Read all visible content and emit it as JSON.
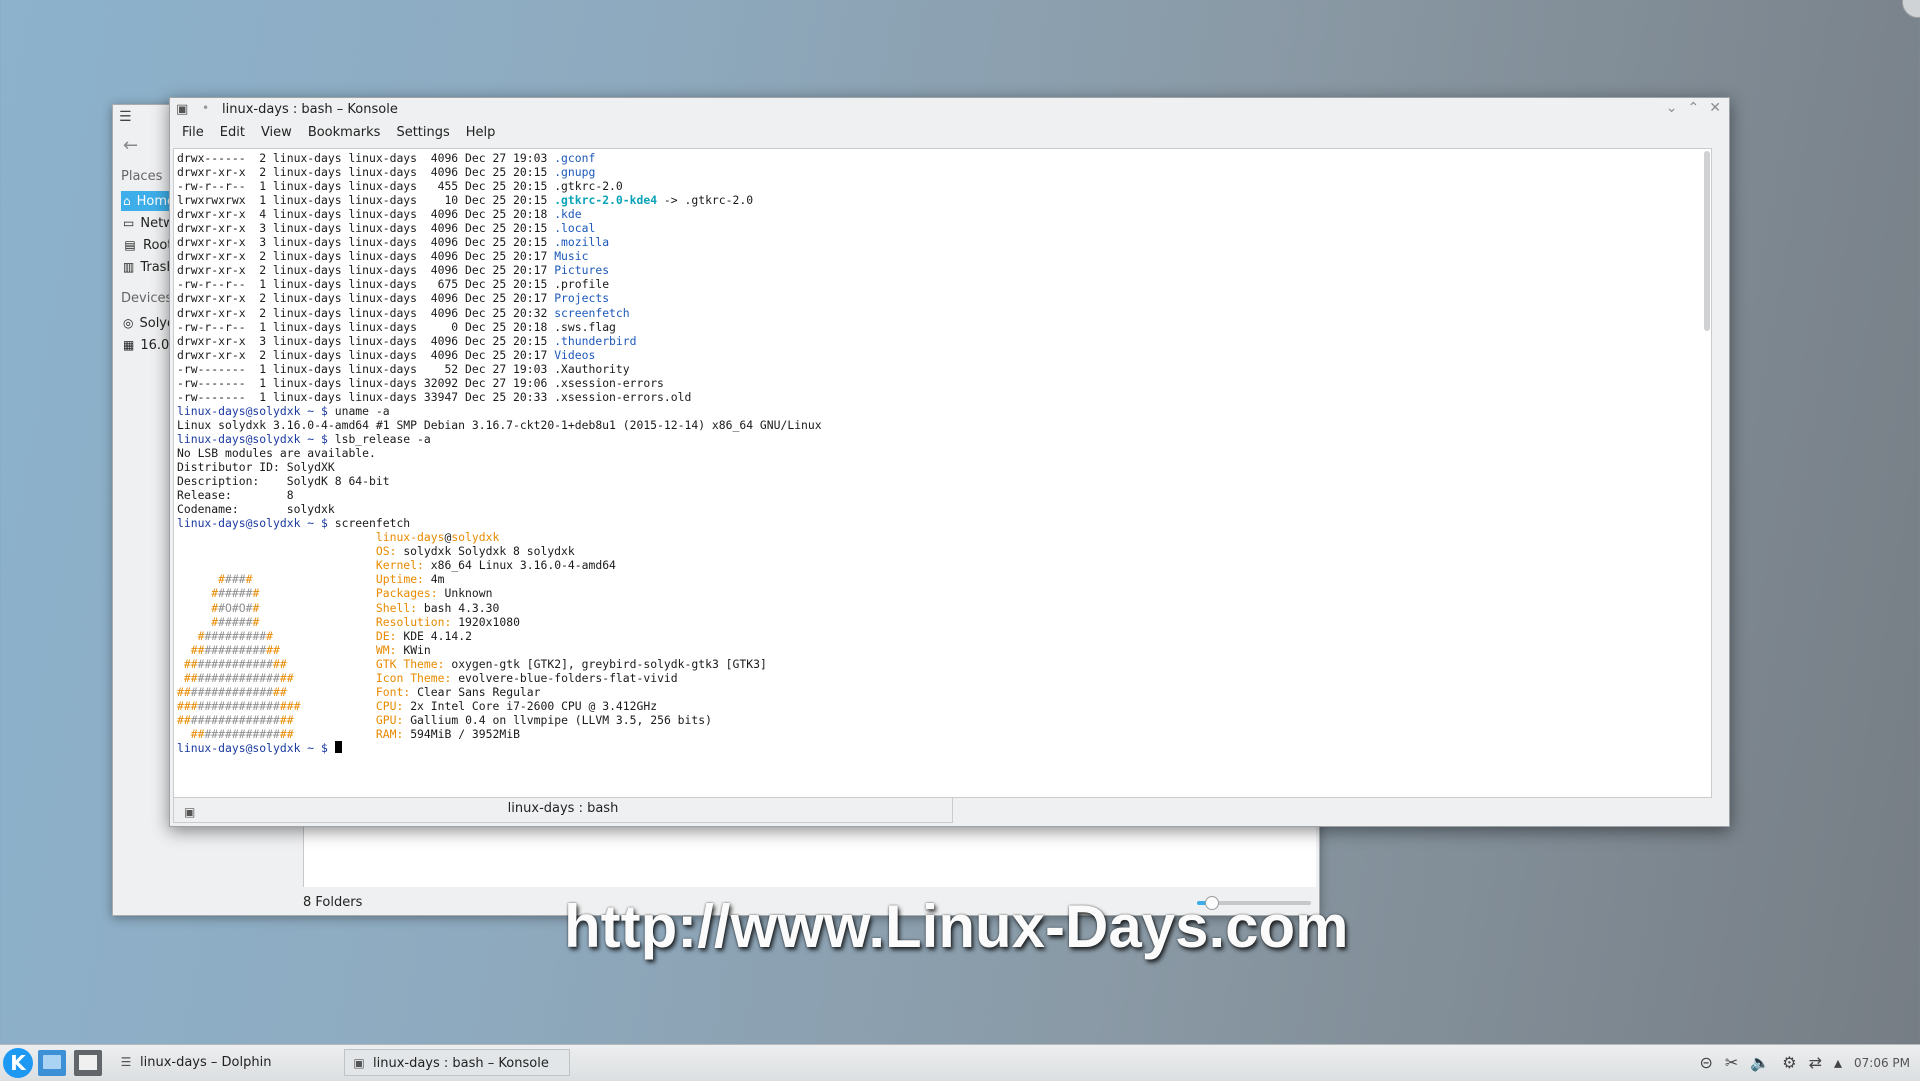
{
  "dolphin": {
    "places_label": "Places",
    "devices_label": "Devices",
    "places": [
      {
        "label": "Home",
        "icon": "home-icon"
      },
      {
        "label": "Network",
        "icon": "network-icon"
      },
      {
        "label": "Root",
        "icon": "root-folder-icon"
      },
      {
        "label": "Trash",
        "icon": "trash-icon"
      }
    ],
    "devices": [
      {
        "label": "SolydXK",
        "icon": "drive-icon"
      },
      {
        "label": "16.0 GiB",
        "icon": "harddisk-icon"
      }
    ],
    "status": "8 Folders",
    "zoom_level": 0.12
  },
  "konsole": {
    "title": "linux-days : bash – Konsole",
    "menu": [
      "File",
      "Edit",
      "View",
      "Bookmarks",
      "Settings",
      "Help"
    ],
    "tab_label": "linux-days : bash",
    "ls_lines": [
      {
        "meta": "drwx------  2 linux-days linux-days  4096 Dec 27 19:03 ",
        "name": ".gconf",
        "cls": "c-blue"
      },
      {
        "meta": "drwxr-xr-x  2 linux-days linux-days  4096 Dec 25 20:15 ",
        "name": ".gnupg",
        "cls": "c-blue"
      },
      {
        "meta": "-rw-r--r--  1 linux-days linux-days   455 Dec 25 20:15 ",
        "name": ".gtkrc-2.0",
        "cls": ""
      },
      {
        "meta": "lrwxrwxrwx  1 linux-days linux-days    10 Dec 25 20:15 ",
        "name": ".gtkrc-2.0-kde4",
        "cls": "c-cyan",
        "suffix": " -> .gtkrc-2.0"
      },
      {
        "meta": "drwxr-xr-x  4 linux-days linux-days  4096 Dec 25 20:18 ",
        "name": ".kde",
        "cls": "c-blue"
      },
      {
        "meta": "drwxr-xr-x  3 linux-days linux-days  4096 Dec 25 20:15 ",
        "name": ".local",
        "cls": "c-blue"
      },
      {
        "meta": "drwxr-xr-x  3 linux-days linux-days  4096 Dec 25 20:15 ",
        "name": ".mozilla",
        "cls": "c-blue"
      },
      {
        "meta": "drwxr-xr-x  2 linux-days linux-days  4096 Dec 25 20:17 ",
        "name": "Music",
        "cls": "c-blue"
      },
      {
        "meta": "drwxr-xr-x  2 linux-days linux-days  4096 Dec 25 20:17 ",
        "name": "Pictures",
        "cls": "c-blue"
      },
      {
        "meta": "-rw-r--r--  1 linux-days linux-days   675 Dec 25 20:15 ",
        "name": ".profile",
        "cls": ""
      },
      {
        "meta": "drwxr-xr-x  2 linux-days linux-days  4096 Dec 25 20:17 ",
        "name": "Projects",
        "cls": "c-blue"
      },
      {
        "meta": "drwxr-xr-x  2 linux-days linux-days  4096 Dec 25 20:32 ",
        "name": "screenfetch",
        "cls": "c-blue"
      },
      {
        "meta": "-rw-r--r--  1 linux-days linux-days     0 Dec 25 20:18 ",
        "name": ".sws.flag",
        "cls": ""
      },
      {
        "meta": "drwxr-xr-x  3 linux-days linux-days  4096 Dec 25 20:15 ",
        "name": ".thunderbird",
        "cls": "c-blue"
      },
      {
        "meta": "drwxr-xr-x  2 linux-days linux-days  4096 Dec 25 20:17 ",
        "name": "Videos",
        "cls": "c-blue"
      },
      {
        "meta": "-rw-------  1 linux-days linux-days    52 Dec 27 19:03 ",
        "name": ".Xauthority",
        "cls": ""
      },
      {
        "meta": "-rw-------  1 linux-days linux-days 32092 Dec 27 19:06 ",
        "name": ".xsession-errors",
        "cls": ""
      },
      {
        "meta": "-rw-------  1 linux-days linux-days 33947 Dec 25 20:33 ",
        "name": ".xsession-errors.old",
        "cls": ""
      }
    ],
    "prompt": "linux-days@solydxk ~ $ ",
    "cmd_uname": "uname -a",
    "uname_out": "Linux solydxk 3.16.0-4-amd64 #1 SMP Debian 3.16.7-ckt20-1+deb8u1 (2015-12-14) x86_64 GNU/Linux",
    "cmd_lsb": "lsb_release -a",
    "lsb_out": [
      "No LSB modules are available.",
      "Distributor ID: SolydXK",
      "Description:    SolydK 8 64-bit",
      "Release:        8",
      "Codename:       solydxk"
    ],
    "cmd_screenfetch": "screenfetch",
    "sf_user": "linux-days",
    "sf_at": "@",
    "sf_host": "solydxk",
    "sf_logo": [
      "",
      "",
      "      #####",
      "     #######",
      "     ##O#O##",
      "     #######",
      "   ###########",
      "  #############",
      " ###############",
      " ################",
      "################",
      "##################",
      "#################",
      "  ###############"
    ],
    "sf_info": [
      {
        "key": "OS: ",
        "val": "solydxk Solydxk 8 solydxk"
      },
      {
        "key": "Kernel: ",
        "val": "x86_64 Linux 3.16.0-4-amd64"
      },
      {
        "key": "Uptime: ",
        "val": "4m"
      },
      {
        "key": "Packages: ",
        "val": "Unknown"
      },
      {
        "key": "Shell: ",
        "val": "bash 4.3.30"
      },
      {
        "key": "Resolution: ",
        "val": "1920x1080"
      },
      {
        "key": "DE: ",
        "val": "KDE 4.14.2"
      },
      {
        "key": "WM: ",
        "val": "KWin"
      },
      {
        "key": "GTK Theme: ",
        "val": "oxygen-gtk [GTK2], greybird-solydk-gtk3 [GTK3]"
      },
      {
        "key": "Icon Theme: ",
        "val": "evolvere-blue-folders-flat-vivid"
      },
      {
        "key": "Font: ",
        "val": "Clear Sans Regular"
      },
      {
        "key": "CPU: ",
        "val": "2x Intel Core i7-2600 CPU @ 3.412GHz"
      },
      {
        "key": "GPU: ",
        "val": "Gallium 0.4 on llvmpipe (LLVM 3.5, 256 bits)"
      },
      {
        "key": "RAM: ",
        "val": "594MiB / 3952MiB"
      }
    ]
  },
  "watermark": "http://www.Linux-Days.com",
  "taskbar": {
    "tasks": [
      {
        "label": "linux-days – Dolphin",
        "icon": "dolphin-icon"
      },
      {
        "label": "linux-days : bash – Konsole",
        "icon": "konsole-icon"
      }
    ],
    "clock": "07:06 PM"
  },
  "colors": {
    "accent": "#3daee9",
    "terminal_blue": "#1d58b9",
    "terminal_cyan": "#0aa3b8",
    "screenfetch_orange": "#e88a00"
  }
}
